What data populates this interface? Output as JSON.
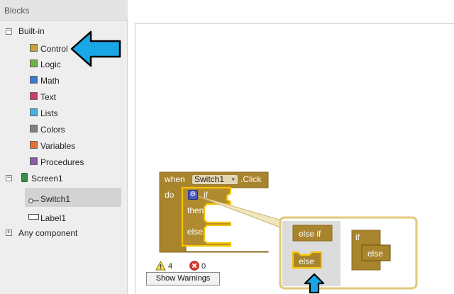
{
  "sidebar": {
    "header": "Blocks",
    "builtin": {
      "label": "Built-in",
      "items": [
        {
          "label": "Control",
          "color": "#c9a13b"
        },
        {
          "label": "Logic",
          "color": "#6fb04a"
        },
        {
          "label": "Math",
          "color": "#3e78c8"
        },
        {
          "label": "Text",
          "color": "#c93f6b"
        },
        {
          "label": "Lists",
          "color": "#45b1de"
        },
        {
          "label": "Colors",
          "color": "#808080"
        },
        {
          "label": "Variables",
          "color": "#e0703a"
        },
        {
          "label": "Procedures",
          "color": "#8a5ba8"
        }
      ]
    },
    "screen": {
      "label": "Screen1",
      "items": [
        {
          "label": "Switch1"
        },
        {
          "label": "Label1"
        }
      ]
    },
    "any_component": "Any component"
  },
  "block": {
    "when": "when",
    "component": "Switch1",
    "event": ".Click",
    "do": "do",
    "if": "if",
    "then": "then",
    "else": "else",
    "color": "#a8842d"
  },
  "mutator": {
    "else_if": "else if",
    "else": "else",
    "if": "if",
    "else_inner": "else"
  },
  "status": {
    "warnings": "4",
    "errors": "0",
    "show_warnings": "Show Warnings"
  },
  "colors": {
    "arrow": "#1aa7e8",
    "block": "#a8842d",
    "highlight": "#f5c400"
  }
}
